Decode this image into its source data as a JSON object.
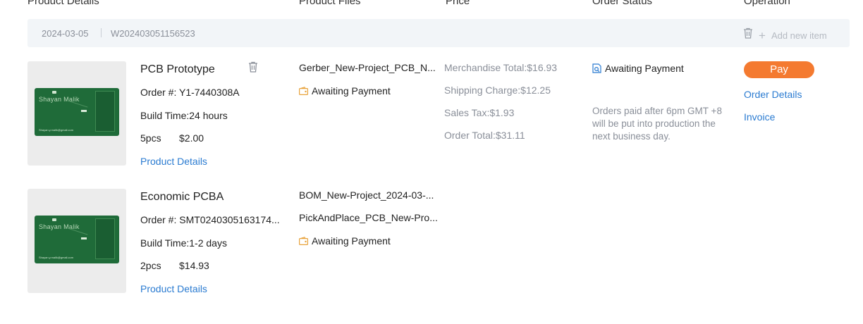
{
  "header": {
    "product_details": "Product Details",
    "product_files": "Product Files",
    "price": "Price",
    "order_status": "Order Status",
    "operation": "Operation"
  },
  "order": {
    "date": "2024-03-05",
    "number": "W202403051156523",
    "add_new_item": "Add new item"
  },
  "items": [
    {
      "title": "PCB Prototype",
      "order_no": "Order #: Y1-7440308A",
      "build_time": "Build Time:24 hours",
      "qty": "5pcs",
      "price": "$2.00",
      "details_link": "Product Details",
      "thumb": {
        "name": "Shayan Malik",
        "email": "Shayan.y.malik@gmail.com"
      },
      "files": [
        "Gerber_New-Project_PCB_N..."
      ],
      "file_status": "Awaiting Payment"
    },
    {
      "title": "Economic PCBA",
      "order_no": "Order #: SMT0240305163174...",
      "build_time": "Build Time:1-2 days",
      "qty": "2pcs",
      "price": "$14.93",
      "details_link": "Product Details",
      "thumb": {
        "name": "Shayan Malik",
        "email": "Shayan.y.malik@gmail.com"
      },
      "files": [
        "BOM_New-Project_2024-03-...",
        "PickAndPlace_PCB_New-Pro..."
      ],
      "file_status": "Awaiting Payment"
    }
  ],
  "price": {
    "merchandise_total": "Merchandise Total:$16.93",
    "shipping_charge": "Shipping Charge:$12.25",
    "sales_tax": "Sales Tax:$1.93",
    "order_total": "Order Total:$31.11"
  },
  "status": {
    "label": "Awaiting Payment",
    "note": "Orders paid after 6pm GMT +8 will be put into production the next business day."
  },
  "operation": {
    "pay": "Pay",
    "order_details": "Order Details",
    "invoice": "Invoice"
  },
  "colors": {
    "accent_orange": "#f47a30",
    "link_blue": "#2a7bd1",
    "bar_background": "#f2f5f8",
    "pcb_green": "#1f6b39"
  }
}
